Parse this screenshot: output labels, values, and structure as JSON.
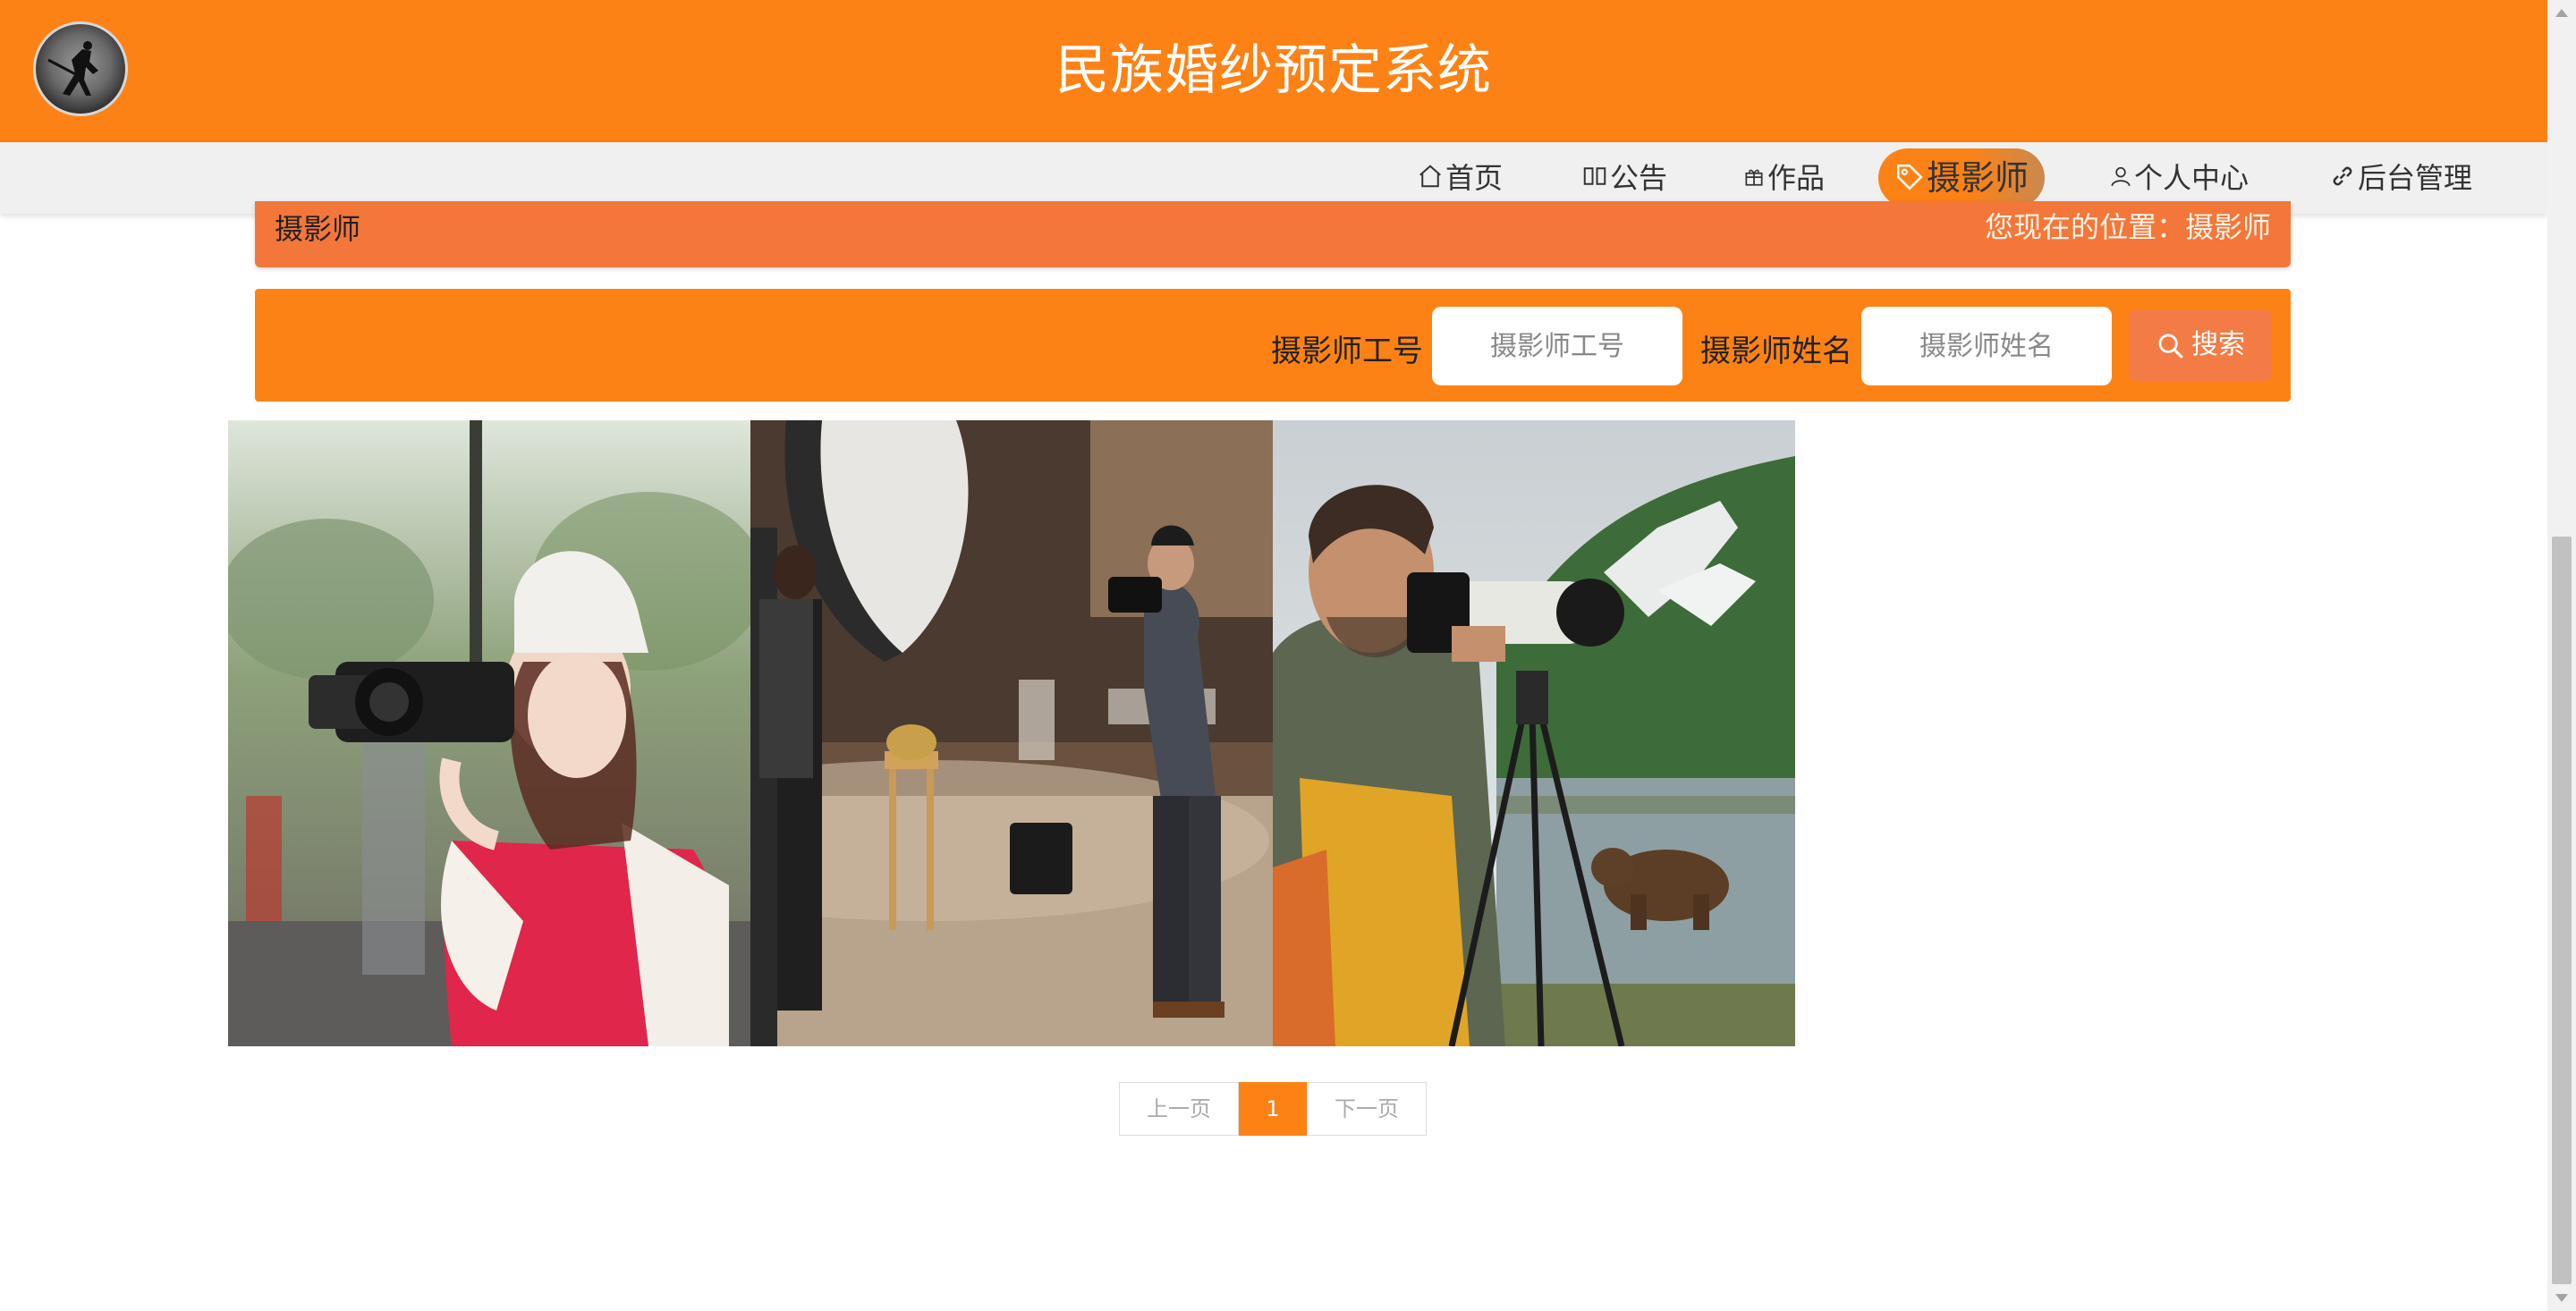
{
  "site": {
    "title": "民族婚纱预定系统"
  },
  "nav": {
    "items": [
      {
        "label": "首页",
        "icon": "home-icon"
      },
      {
        "label": "公告",
        "icon": "book-icon"
      },
      {
        "label": "作品",
        "icon": "gift-icon"
      },
      {
        "label": "摄影师",
        "icon": "tag-icon",
        "active": true
      },
      {
        "label": "个人中心",
        "icon": "user-icon"
      },
      {
        "label": "后台管理",
        "icon": "link-icon"
      }
    ]
  },
  "breadcrumb": {
    "title": "摄影师",
    "location": "您现在的位置：摄影师"
  },
  "search": {
    "id_label": "摄影师工号",
    "id_placeholder": "摄影师工号",
    "name_label": "摄影师姓名",
    "name_placeholder": "摄影师姓名",
    "button_label": "搜索"
  },
  "photos": [
    {
      "icon": "photographer-woman-photo"
    },
    {
      "icon": "photographer-studio-photo"
    },
    {
      "icon": "photographer-bear-photo"
    }
  ],
  "pagination": {
    "prev": "上一页",
    "current": "1",
    "next": "下一页"
  },
  "colors": {
    "primary": "#fd8215",
    "breadcrumb": "#f3773a",
    "nav_bg": "#f0f0f0"
  }
}
